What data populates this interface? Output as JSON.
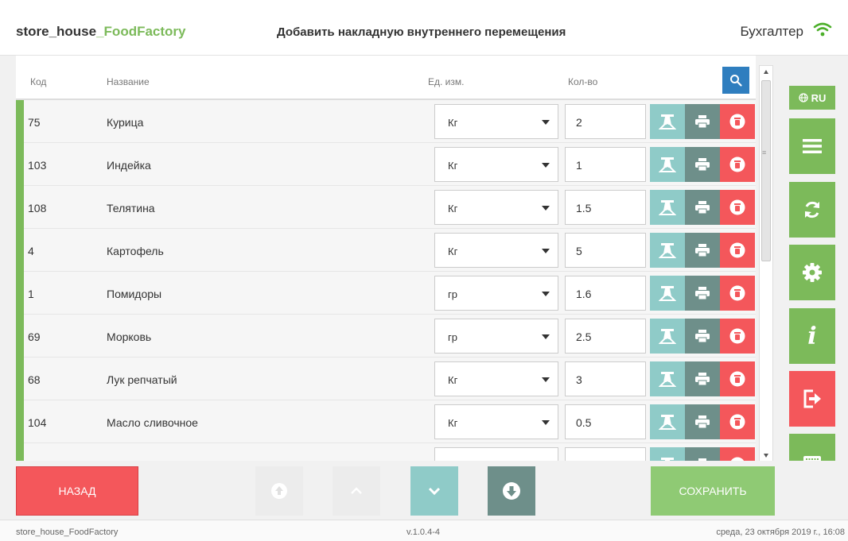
{
  "header": {
    "brand_main": "store_house",
    "brand_accent": "_FoodFactory",
    "title": "Добавить накладную внутреннего перемещения",
    "user_role": "Бухгалтер"
  },
  "table": {
    "columns": {
      "code": "Код",
      "name": "Название",
      "unit": "Ед. изм.",
      "qty": "Кол-во"
    },
    "rows": [
      {
        "code": "75",
        "name": "Курица",
        "unit": "Кг",
        "qty": "2"
      },
      {
        "code": "103",
        "name": "Индейка",
        "unit": "Кг",
        "qty": "1"
      },
      {
        "code": "108",
        "name": "Телятина",
        "unit": "Кг",
        "qty": "1.5"
      },
      {
        "code": "4",
        "name": "Картофель",
        "unit": "Кг",
        "qty": "5"
      },
      {
        "code": "1",
        "name": "Помидоры",
        "unit": "гр",
        "qty": "1.6"
      },
      {
        "code": "69",
        "name": "Морковь",
        "unit": "гр",
        "qty": "2.5"
      },
      {
        "code": "68",
        "name": "Лук репчатый",
        "unit": "Кг",
        "qty": "3"
      },
      {
        "code": "104",
        "name": "Масло сливочное",
        "unit": "Кг",
        "qty": "0.5"
      },
      {
        "code": "",
        "name": "",
        "unit": "",
        "qty": ""
      }
    ]
  },
  "side": {
    "lang": "RU"
  },
  "bottom": {
    "back_label": "НАЗАД",
    "save_label": "СОХРАНИТЬ"
  },
  "status": {
    "app": "store_house_FoodFactory",
    "version": "v.1.0.4-4",
    "datetime": "среда, 23 октября 2019 г., 16:08"
  },
  "colors": {
    "accent_green": "#7cba5a",
    "danger_red": "#f4575b",
    "teal": "#8fcbc8",
    "dark_teal": "#6e8f8a",
    "search_blue": "#2f7ebf"
  },
  "icons": [
    "wifi-icon",
    "search-icon",
    "scales-icon",
    "print-icon",
    "trash-icon",
    "globe-icon",
    "menu-icon",
    "sync-icon",
    "gear-icon",
    "info-icon",
    "logout-icon",
    "keyboard-icon",
    "arrow-circle-up-icon",
    "chevron-up-icon",
    "chevron-down-icon",
    "arrow-circle-down-icon"
  ]
}
